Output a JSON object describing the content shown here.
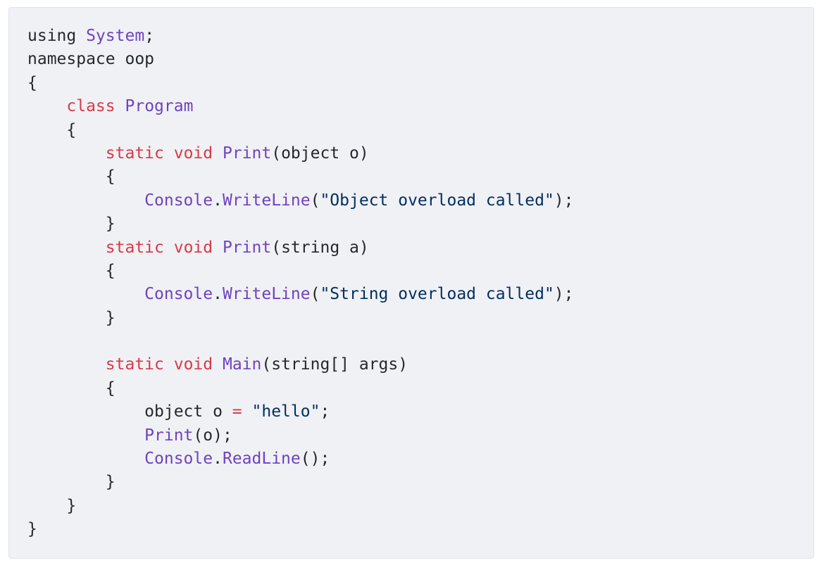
{
  "colors": {
    "background": "#f0f1f4",
    "keyword": "#d73a49",
    "type": "#6f42c1",
    "string": "#032f62",
    "plain": "#24292e"
  },
  "code_lines": [
    [
      [
        "pl",
        "using "
      ],
      [
        "ty",
        "System"
      ],
      [
        "pl",
        ";"
      ]
    ],
    [
      [
        "pl",
        "namespace oop"
      ]
    ],
    [
      [
        "pl",
        "{"
      ]
    ],
    [
      [
        "pl",
        "    "
      ],
      [
        "kw",
        "class"
      ],
      [
        "pl",
        " "
      ],
      [
        "ty",
        "Program"
      ]
    ],
    [
      [
        "pl",
        "    {"
      ]
    ],
    [
      [
        "pl",
        "        "
      ],
      [
        "kw",
        "static"
      ],
      [
        "pl",
        " "
      ],
      [
        "kw",
        "void"
      ],
      [
        "pl",
        " "
      ],
      [
        "ty",
        "Print"
      ],
      [
        "pl",
        "(object o)"
      ]
    ],
    [
      [
        "pl",
        "        {"
      ]
    ],
    [
      [
        "pl",
        "            "
      ],
      [
        "ty",
        "Console"
      ],
      [
        "pl",
        "."
      ],
      [
        "ty",
        "WriteLine"
      ],
      [
        "pl",
        "("
      ],
      [
        "str",
        "\"Object overload called\""
      ],
      [
        "pl",
        ");"
      ]
    ],
    [
      [
        "pl",
        "        }"
      ]
    ],
    [
      [
        "pl",
        "        "
      ],
      [
        "kw",
        "static"
      ],
      [
        "pl",
        " "
      ],
      [
        "kw",
        "void"
      ],
      [
        "pl",
        " "
      ],
      [
        "ty",
        "Print"
      ],
      [
        "pl",
        "(string a)"
      ]
    ],
    [
      [
        "pl",
        "        {"
      ]
    ],
    [
      [
        "pl",
        "            "
      ],
      [
        "ty",
        "Console"
      ],
      [
        "pl",
        "."
      ],
      [
        "ty",
        "WriteLine"
      ],
      [
        "pl",
        "("
      ],
      [
        "str",
        "\"String overload called\""
      ],
      [
        "pl",
        ");"
      ]
    ],
    [
      [
        "pl",
        "        }"
      ]
    ],
    [
      [
        "pl",
        ""
      ]
    ],
    [
      [
        "pl",
        "        "
      ],
      [
        "kw",
        "static"
      ],
      [
        "pl",
        " "
      ],
      [
        "kw",
        "void"
      ],
      [
        "pl",
        " "
      ],
      [
        "ty",
        "Main"
      ],
      [
        "pl",
        "(string[] args)"
      ]
    ],
    [
      [
        "pl",
        "        {"
      ]
    ],
    [
      [
        "pl",
        "            object o "
      ],
      [
        "op",
        "="
      ],
      [
        "pl",
        " "
      ],
      [
        "str",
        "\"hello\""
      ],
      [
        "pl",
        ";"
      ]
    ],
    [
      [
        "pl",
        "            "
      ],
      [
        "ty",
        "Print"
      ],
      [
        "pl",
        "(o);"
      ]
    ],
    [
      [
        "pl",
        "            "
      ],
      [
        "ty",
        "Console"
      ],
      [
        "pl",
        "."
      ],
      [
        "ty",
        "ReadLine"
      ],
      [
        "pl",
        "();"
      ]
    ],
    [
      [
        "pl",
        "        }"
      ]
    ],
    [
      [
        "pl",
        "    }"
      ]
    ],
    [
      [
        "pl",
        "}"
      ]
    ]
  ]
}
